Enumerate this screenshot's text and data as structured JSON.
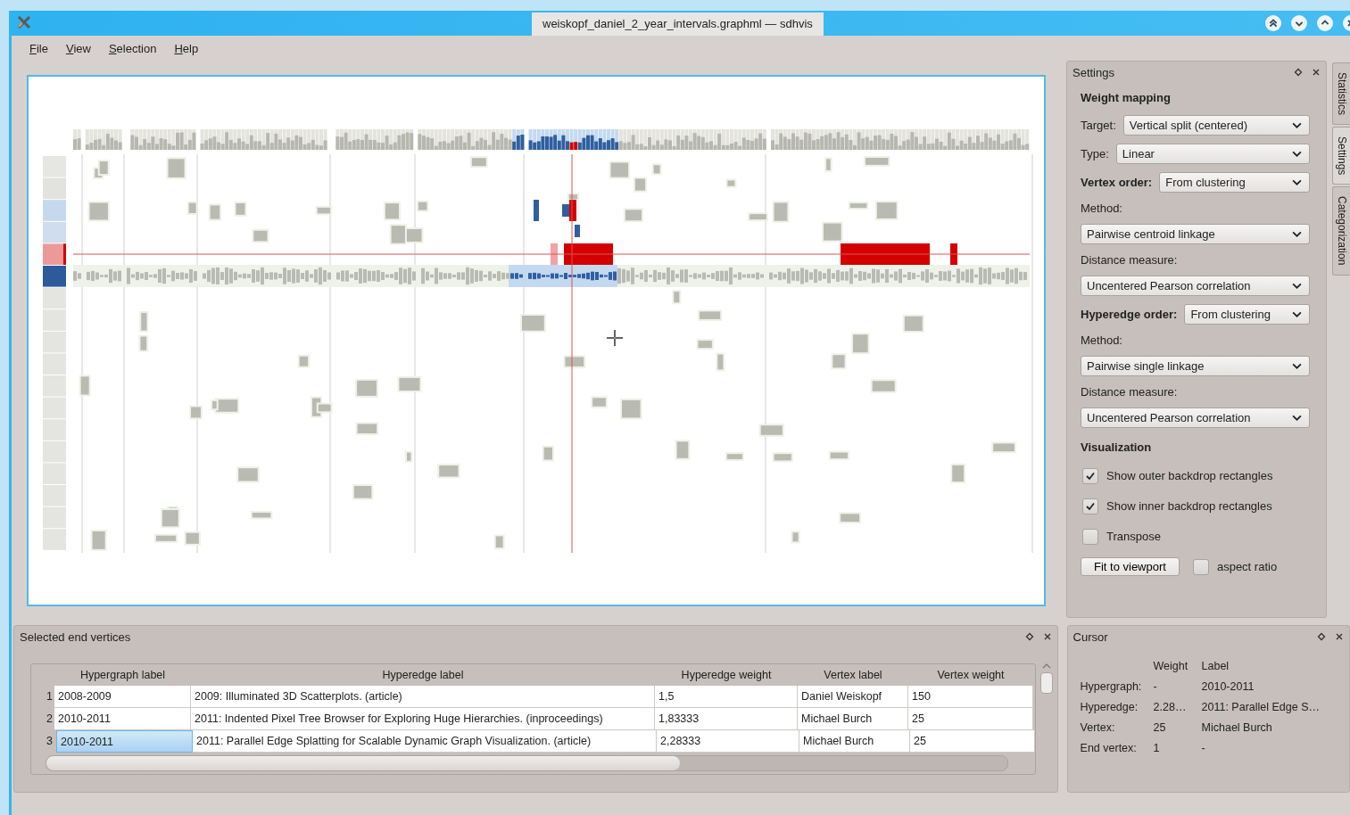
{
  "window": {
    "title": "weiskopf_daniel_2_year_intervals.graphml — sdhvis"
  },
  "menu": [
    {
      "label": "File"
    },
    {
      "label": "View"
    },
    {
      "label": "Selection"
    },
    {
      "label": "Help"
    }
  ],
  "settings": {
    "title": "Settings",
    "rows": [
      {
        "kind": "heading",
        "text": "Weight mapping"
      },
      {
        "kind": "combo",
        "label": "Target:",
        "value": "Vertical split (centered)",
        "strong": false
      },
      {
        "kind": "combo",
        "label": "Type:",
        "value": "Linear",
        "strong": false
      },
      {
        "kind": "combo",
        "label": "Vertex order:",
        "value": "From clustering",
        "strong": true
      },
      {
        "kind": "label",
        "text": "Method:"
      },
      {
        "kind": "wide_combo",
        "value": "Pairwise centroid linkage"
      },
      {
        "kind": "label",
        "text": "Distance measure:"
      },
      {
        "kind": "wide_combo",
        "value": "Uncentered Pearson correlation"
      },
      {
        "kind": "combo",
        "label": "Hyperedge order:",
        "value": "From clustering",
        "strong": true
      },
      {
        "kind": "label",
        "text": "Method:"
      },
      {
        "kind": "wide_combo",
        "value": "Pairwise single linkage"
      },
      {
        "kind": "label",
        "text": "Distance measure:"
      },
      {
        "kind": "wide_combo",
        "value": "Uncentered Pearson correlation"
      },
      {
        "kind": "heading",
        "text": "Visualization"
      },
      {
        "kind": "checkbox",
        "label": "Show outer backdrop rectangles",
        "checked": true
      },
      {
        "kind": "checkbox",
        "label": "Show inner backdrop rectangles",
        "checked": true
      },
      {
        "kind": "checkbox",
        "label": "Transpose",
        "checked": false
      },
      {
        "kind": "button_check",
        "button": "Fit to viewport",
        "label": "aspect ratio",
        "checked": false
      }
    ]
  },
  "side_tabs": [
    {
      "label": "Statistics",
      "selected": false
    },
    {
      "label": "Settings",
      "selected": true
    },
    {
      "label": "Categorization",
      "selected": false
    }
  ],
  "selection_panel": {
    "title": "Selected end vertices",
    "columns": [
      "Hypergraph label",
      "Hyperedge label",
      "Hyperedge weight",
      "Vertex label",
      "Vertex weight"
    ],
    "rows": [
      {
        "number": "1",
        "cells": [
          {
            "text": "2008-2009",
            "selected": false
          },
          {
            "text": "2009: Illuminated 3D Scatterplots. (article)",
            "selected": false
          },
          {
            "text": "1,5",
            "selected": false
          },
          {
            "text": "Daniel Weiskopf",
            "selected": false
          },
          {
            "text": "150",
            "selected": false
          }
        ]
      },
      {
        "number": "2",
        "cells": [
          {
            "text": "2010-2011",
            "selected": false
          },
          {
            "text": "2011: Indented Pixel Tree Browser for Exploring Huge Hierarchies. (inproceedings)",
            "selected": false
          },
          {
            "text": "1,83333",
            "selected": false
          },
          {
            "text": "Michael Burch",
            "selected": false
          },
          {
            "text": "25",
            "selected": false
          }
        ]
      },
      {
        "number": "3",
        "cells": [
          {
            "text": "2010-2011",
            "selected": true
          },
          {
            "text": "2011: Parallel Edge Splatting for Scalable Dynamic Graph Visualization. (article)",
            "selected": false
          },
          {
            "text": "2,28333",
            "selected": false
          },
          {
            "text": "Michael Burch",
            "selected": false
          },
          {
            "text": "25",
            "selected": false
          }
        ]
      }
    ]
  },
  "cursor_panel": {
    "title": "Cursor",
    "columns": [
      "Weight",
      "Label"
    ],
    "rows": [
      {
        "label": "Hypergraph:",
        "weight": "-",
        "text": "2010-2011"
      },
      {
        "label": "Hyperedge:",
        "weight": "2.28…",
        "text": "2011: Parallel Edge S…"
      },
      {
        "label": "Vertex:",
        "weight": "25",
        "text": "Michael Burch"
      },
      {
        "label": "End vertex:",
        "weight": "1",
        "text": "-"
      }
    ]
  }
}
